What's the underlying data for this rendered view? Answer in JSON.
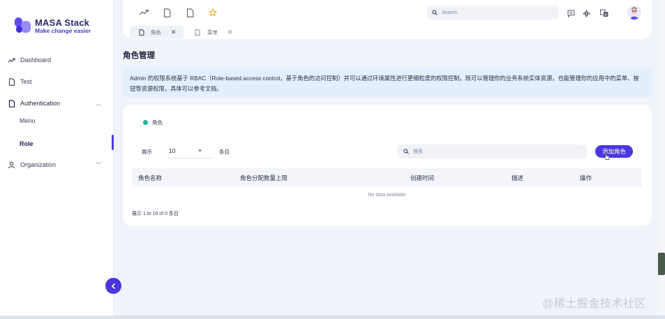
{
  "brand": {
    "title": "MASA Stack",
    "subtitle": "Make change easier",
    "colors": {
      "accent": "#4a36e0",
      "logo_a": "#5b4df0",
      "logo_b": "#8b7ff8",
      "status_dot": "#1ab394"
    }
  },
  "sidebar": {
    "items": [
      {
        "label": "Dashboard",
        "icon": "trend-icon"
      },
      {
        "label": "Test",
        "icon": "document-icon"
      },
      {
        "label": "Authentication",
        "icon": "document-icon",
        "expanded": true
      },
      {
        "label": "Menu"
      },
      {
        "label": "Role",
        "active": true
      },
      {
        "label": "Organization",
        "icon": "user-icon"
      }
    ]
  },
  "topbar": {
    "search_placeholder": "Search",
    "tabs": [
      {
        "label": "角色",
        "active": true
      },
      {
        "label": "菜单",
        "active": false
      }
    ]
  },
  "page": {
    "title": "角色管理",
    "description": "Admin 的权限系统基于 RBAC（Role-based access control，基于角色的访问控制）并可以通过环境属性进行更细粒度的权限控制。既可以管理你的业务系统实体资源，也能管理你的应用中的菜单、按钮等资源权限，具体可以参考文档。"
  },
  "card": {
    "legend_label": "角色",
    "show_label": "展示",
    "per_page_value": "10",
    "entries_label": "条目",
    "search_placeholder": "搜索",
    "add_button": "添加角色",
    "columns": [
      "角色名称",
      "角色分配数量上限",
      "创建时间",
      "描述",
      "操作"
    ],
    "empty_text": "No data available",
    "pagination_text": "展示 1 to 10 of 0 条目"
  },
  "watermark": "@稀土掘金技术社区"
}
